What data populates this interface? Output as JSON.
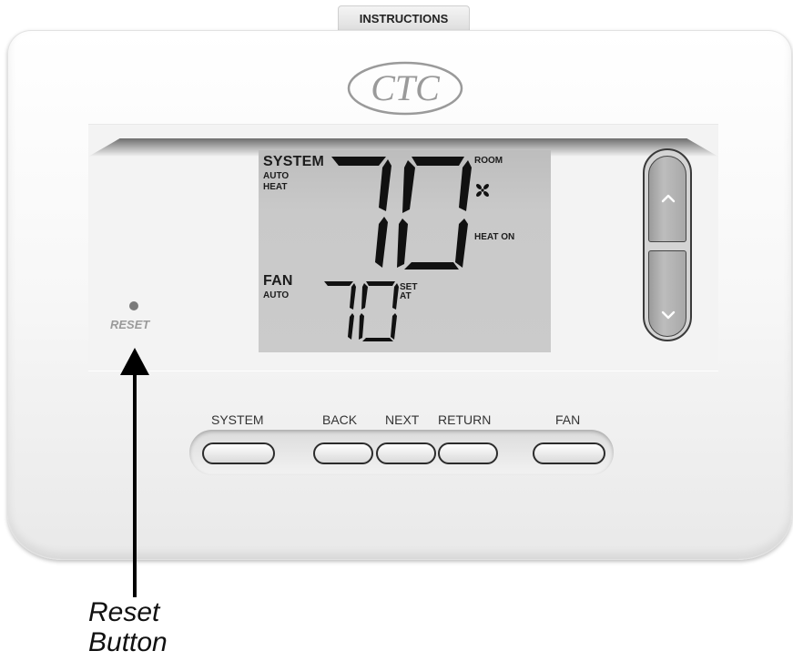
{
  "header": {
    "tab_label": "INSTRUCTIONS"
  },
  "brand": {
    "logo_text": "CTC"
  },
  "display": {
    "system_label": "SYSTEM",
    "system_modes": [
      "AUTO",
      "HEAT"
    ],
    "room_temp": "70",
    "room_label": "ROOM",
    "status_label": "HEAT ON",
    "fan_label": "FAN",
    "fan_mode": "AUTO",
    "set_temp": "70",
    "set_label": [
      "SET",
      "AT"
    ]
  },
  "reset": {
    "label": "RESET"
  },
  "buttons": {
    "system": "SYSTEM",
    "back": "BACK",
    "next": "NEXT",
    "return": "RETURN",
    "fan": "FAN"
  },
  "callout": {
    "line1": "Reset",
    "line2": "Button"
  }
}
